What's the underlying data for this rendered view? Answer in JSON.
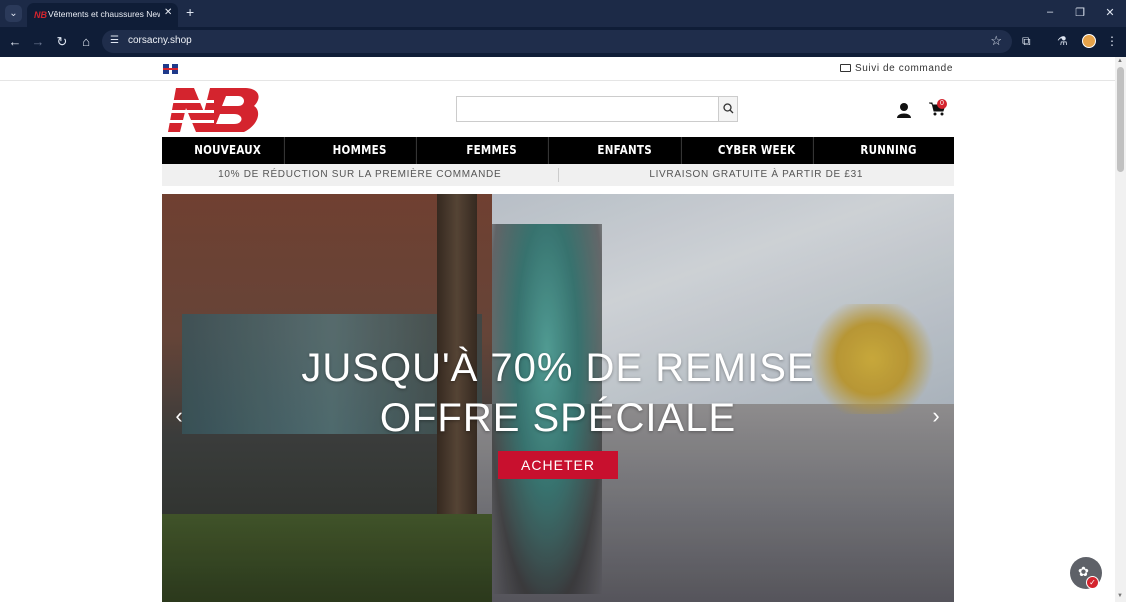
{
  "browser": {
    "tab_title": "Vêtements et chaussures New Balance",
    "tab_close": "✕",
    "new_tab": "+",
    "tab_menu": "⌄",
    "url": "corsacny.shop",
    "controls": {
      "minimize": "–",
      "maximize": "❐",
      "close": "✕"
    }
  },
  "header": {
    "track_order": "Suivi de commande",
    "cart_count": "0",
    "search_placeholder": ""
  },
  "nav": {
    "items": [
      "NOUVEAUX",
      "HOMMES",
      "FEMMES",
      "ENFANTS",
      "CYBER WEEK",
      "RUNNING"
    ]
  },
  "promo": {
    "left": "10% DE RÉDUCTION SUR LA PREMIÈRE COMMANDE",
    "right": "LIVRAISON GRATUITE À PARTIR DE £31"
  },
  "hero": {
    "line1": "JUSQU'À 70% DE REMISE",
    "line2": "OFFRE SPÉCIALE",
    "cta": "ACHETER",
    "prev": "‹",
    "next": "›"
  },
  "colors": {
    "brand_red": "#c8102e",
    "nav_black": "#000000",
    "chrome_dark": "#0f1d37"
  }
}
